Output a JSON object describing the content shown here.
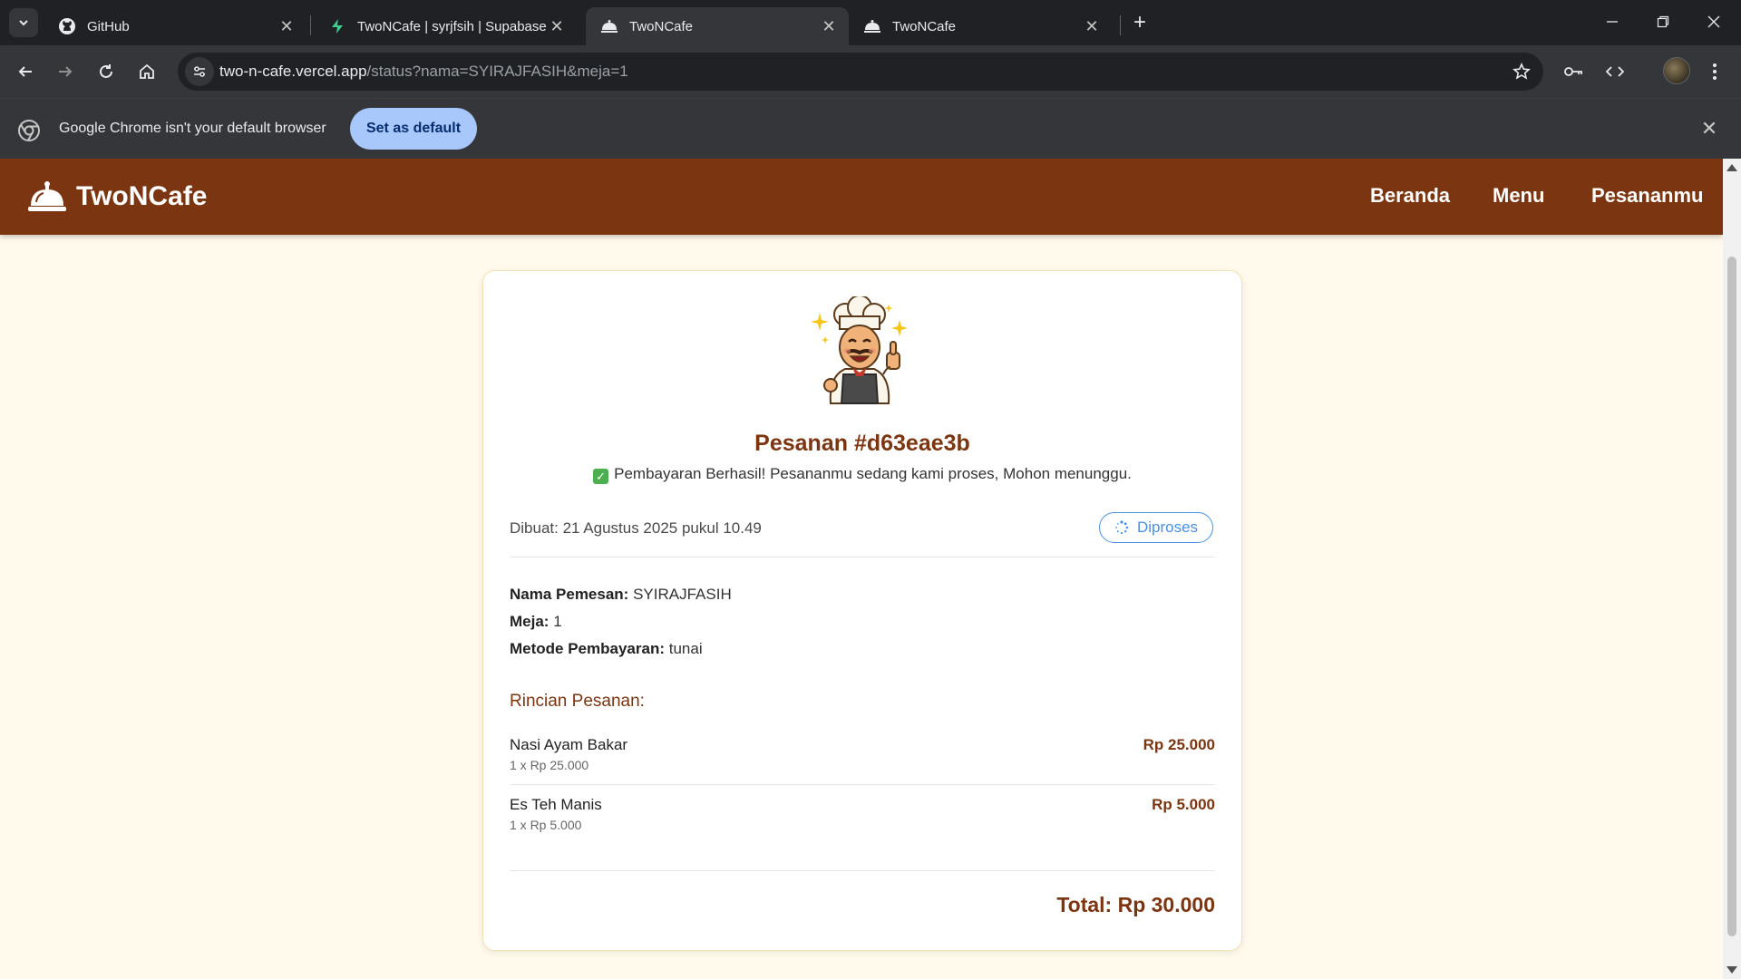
{
  "browser": {
    "tabs": [
      {
        "title": "GitHub",
        "icon": "github-icon",
        "active": false
      },
      {
        "title": "TwoNCafe | syrjfsih | Supabase",
        "icon": "supabase-icon",
        "active": false
      },
      {
        "title": "TwoNCafe",
        "icon": "cloche-icon",
        "active": true
      },
      {
        "title": "TwoNCafe",
        "icon": "cloche-icon",
        "active": false
      }
    ],
    "url_domain": "two-n-cafe.vercel.app",
    "url_path": "/status?nama=SYIRAJFASIH&meja=1",
    "infobar": {
      "message": "Google Chrome isn't your default browser",
      "button": "Set as default"
    }
  },
  "site": {
    "brand": "TwoNCafe",
    "nav": [
      "Beranda",
      "Menu",
      "Pesananmu"
    ],
    "colors": {
      "primary": "#7b3510",
      "background": "#fffaeb",
      "status": "#4a90e2"
    }
  },
  "order": {
    "title": "Pesanan #d63eae3b",
    "success_message": "Pembayaran Berhasil! Pesananmu sedang kami proses, Mohon menunggu.",
    "created": "Dibuat: 21 Agustus 2025 pukul 10.49",
    "status": "Diproses",
    "customer_label": "Nama Pemesan:",
    "customer": "SYIRAJFASIH",
    "table_label": "Meja:",
    "table": "1",
    "payment_label": "Metode Pembayaran:",
    "payment": "tunai",
    "details_heading": "Rincian Pesanan:",
    "items": [
      {
        "name": "Nasi Ayam Bakar",
        "qty_price": "1 x Rp 25.000",
        "subtotal": "Rp 25.000"
      },
      {
        "name": "Es Teh Manis",
        "qty_price": "1 x Rp 5.000",
        "subtotal": "Rp 5.000"
      }
    ],
    "total": "Total: Rp 30.000"
  }
}
